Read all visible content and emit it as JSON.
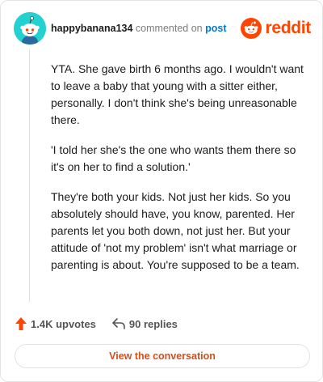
{
  "header": {
    "username": "happybanana134",
    "action_text": "commented on",
    "post_link": "post",
    "brand": "reddit",
    "avatar_icon": "snoo-avatar-icon",
    "brand_icon": "reddit-logo-icon"
  },
  "comment": {
    "paragraphs": [
      "YTA. She gave birth 6 months ago. I wouldn't want to leave a baby that young with a sitter either, personally. I don't think she's being unreasonable there.",
      "'I told her she's the one who wants them there so it's on her to find a solution.'",
      "They're both your kids. Not just her kids. So you absolutely should have, you know, parented. Her parents let you both down, not just her. But your attitude of 'not my problem' isn't what marriage or parenting is about. You're supposed to be a team."
    ]
  },
  "actions": {
    "upvotes": "1.4K upvotes",
    "replies": "90 replies",
    "upvote_icon": "upvote-arrow-icon",
    "reply_icon": "reply-arrow-icon"
  },
  "cta": {
    "label": "View the conversation"
  },
  "colors": {
    "accent": "#ff4500",
    "link": "#0079d3",
    "avatar_bg": "#24d1d1",
    "cta_text": "#d94d1a"
  }
}
